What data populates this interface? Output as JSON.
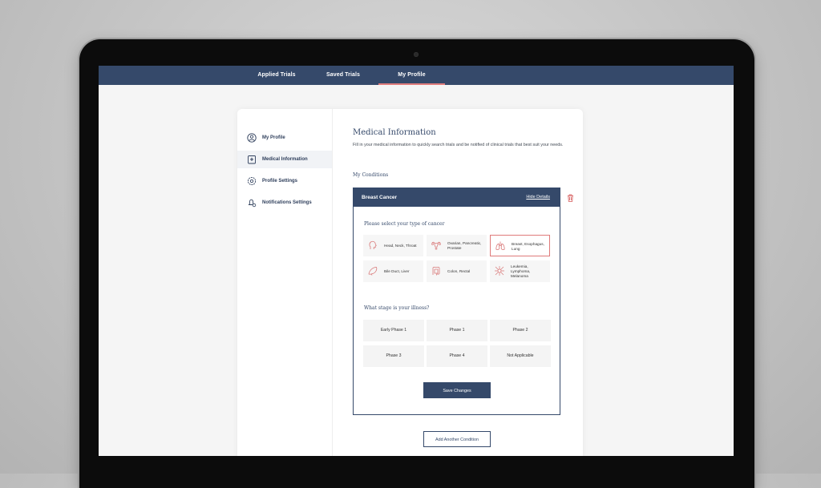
{
  "top_nav": {
    "tabs": [
      {
        "label": "Applied Trials",
        "active": false
      },
      {
        "label": "Saved Trials",
        "active": false
      },
      {
        "label": "My Profile",
        "active": true
      }
    ]
  },
  "sidebar": {
    "items": [
      {
        "label": "My Profile",
        "icon": "user-circle-icon",
        "active": false
      },
      {
        "label": "Medical Information",
        "icon": "medical-badge-icon",
        "active": true
      },
      {
        "label": "Profile Settings",
        "icon": "gear-icon",
        "active": false
      },
      {
        "label": "Notifications Settings",
        "icon": "bell-gear-icon",
        "active": false
      }
    ]
  },
  "main": {
    "title": "Medical Information",
    "description": "Fill in your medical information to quickly search trials and be notified of clinical trials that best suit your needs.",
    "conditions_heading": "My Conditions",
    "condition": {
      "name": "Breast Cancer",
      "toggle_link": "Hide Details",
      "cancer_question": "Please select your type of cancer",
      "cancer_types": [
        {
          "label": "Head, Neck, Throat",
          "icon": "head-icon",
          "selected": false
        },
        {
          "label": "Ovarian, Pancreatic, Prostate",
          "icon": "uterus-icon",
          "selected": false
        },
        {
          "label": "Breast, Esophagus, Lung",
          "icon": "lungs-icon",
          "selected": true
        },
        {
          "label": "Bile Duct, Liver",
          "icon": "liver-icon",
          "selected": false
        },
        {
          "label": "Colon, Rectal",
          "icon": "colon-icon",
          "selected": false
        },
        {
          "label": "Leukemia, Lymphoma, Melanoma",
          "icon": "cell-icon",
          "selected": false
        }
      ],
      "stage_question": "What stage is your illness?",
      "stages": [
        "Early Phase 1",
        "Phase 1",
        "Phase 2",
        "Phase 3",
        "Phase 4",
        "Not Applicable"
      ],
      "save_label": "Save Changes"
    },
    "add_condition_label": "Add Another Condition"
  },
  "colors": {
    "navy": "#35496a",
    "accent_pink": "#e07c7c"
  }
}
